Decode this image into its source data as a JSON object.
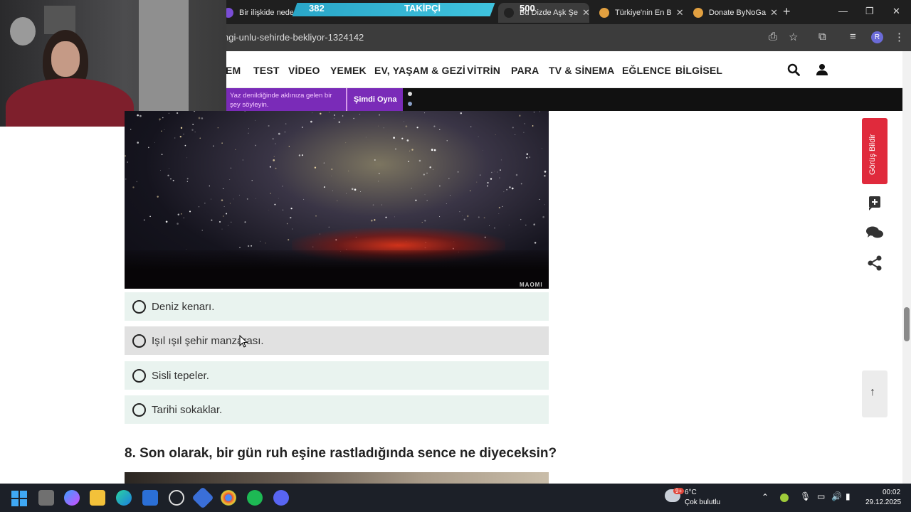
{
  "browser": {
    "tabs": [
      {
        "title": "Bir ilişkide neden",
        "fav": "#7a4dd6"
      },
      {
        "title": "Bu Dizde Aşk Şe",
        "fav": "#222222"
      },
      {
        "title": "Türkiye'nin En B",
        "fav": "#e2a040"
      },
      {
        "title": "Donate ByNoGa",
        "fav": "#e2a040"
      }
    ],
    "url": "ngi-unlu-sehirde-bekliyor-1324142",
    "profile_initial": "R"
  },
  "stream_overlay": {
    "followers_current": "382",
    "followers_label": "TAKİPÇİ",
    "followers_goal": "500"
  },
  "site_nav": {
    "items": [
      "EM",
      "TEST",
      "VİDEO",
      "YEMEK",
      "EV, YAŞAM & GEZİ",
      "VİTRİN",
      "PARA",
      "TV & SİNEMA",
      "EĞLENCE",
      "BİLGİSEL"
    ]
  },
  "ad": {
    "text": "Yaz denildiğinde aklınıza gelen bir şey söyleyin.",
    "cta": "Şimdi Oyna"
  },
  "quiz": {
    "image_credit": "MAOMI",
    "options": [
      "Deniz kenarı.",
      "Işıl ışıl şehir manzarası.",
      "Sisli tepeler.",
      "Tarihi sokaklar."
    ],
    "hovered_index": 1,
    "next_question": "8. Son olarak, bir gün ruh eşine rastladığında sence ne diyeceksin?"
  },
  "side_actions": {
    "feedback_label": "Görüş Bildir"
  },
  "taskbar": {
    "weather_temp": "6°C",
    "weather_desc": "Çok bulutlu",
    "weather_badge": "9+",
    "time": "00:02",
    "date": "29.12.2025"
  }
}
